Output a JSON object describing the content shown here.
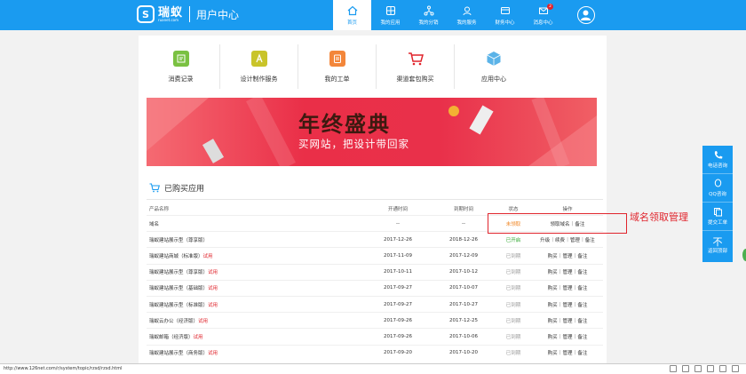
{
  "header": {
    "logo_mark": "S",
    "logo_name": "瑞蚁",
    "logo_url": "ruanet.com",
    "page_title": "用户中心",
    "nav": [
      {
        "label": "首页",
        "icon": "home-icon",
        "active": true
      },
      {
        "label": "我的应用",
        "icon": "grid-icon"
      },
      {
        "label": "我的分销",
        "icon": "share-icon"
      },
      {
        "label": "我的服务",
        "icon": "service-icon"
      },
      {
        "label": "财务中心",
        "icon": "wallet-icon"
      },
      {
        "label": "消息中心",
        "icon": "mail-icon",
        "badge": "2"
      }
    ]
  },
  "quick_links": [
    {
      "label": "消费记录",
      "icon": "bill-icon",
      "color": "#7ac142"
    },
    {
      "label": "设计制作服务",
      "icon": "design-icon",
      "color": "#c9c42a"
    },
    {
      "label": "我的工单",
      "icon": "clipboard-icon",
      "color": "#f3863a"
    },
    {
      "label": "渠道套包购买",
      "icon": "cart-icon",
      "color": "#e0242c"
    },
    {
      "label": "应用中心",
      "icon": "cube-icon",
      "color": "#45a8e0"
    }
  ],
  "banner": {
    "title": "年终盛典",
    "subtitle": "买网站，把设计带回家"
  },
  "section": {
    "title": "已购买应用"
  },
  "table": {
    "headers": [
      "产品名称",
      "开通时间",
      "到期时间",
      "状态",
      "操作"
    ],
    "rows": [
      {
        "name": "域名",
        "trial": "",
        "open": "--",
        "expire": "--",
        "status": "未领取",
        "status_kind": "orange",
        "ops": [
          "领取域名",
          "备注"
        ]
      },
      {
        "name": "瑞蚁建站展示型（尊享版）",
        "trial": "",
        "open": "2017-12-26",
        "expire": "2018-12-26",
        "status": "已开启",
        "status_kind": "green",
        "ops": [
          "升级",
          "续费",
          "管理",
          "备注"
        ]
      },
      {
        "name": "瑞蚁建站商城（标准版）",
        "trial": "试用",
        "open": "2017-11-09",
        "expire": "2017-12-09",
        "status": "已到期",
        "status_kind": "gray",
        "ops": [
          "购买",
          "管理",
          "备注"
        ]
      },
      {
        "name": "瑞蚁建站展示型（尊享版）",
        "trial": "试用",
        "open": "2017-10-11",
        "expire": "2017-10-12",
        "status": "已到期",
        "status_kind": "gray",
        "ops": [
          "购买",
          "管理",
          "备注"
        ]
      },
      {
        "name": "瑞蚁建站展示型（基础版）",
        "trial": "试用",
        "open": "2017-09-27",
        "expire": "2017-10-07",
        "status": "已到期",
        "status_kind": "gray",
        "ops": [
          "购买",
          "管理",
          "备注"
        ]
      },
      {
        "name": "瑞蚁建站展示型（标准版）",
        "trial": "试用",
        "open": "2017-09-27",
        "expire": "2017-10-27",
        "status": "已到期",
        "status_kind": "gray",
        "ops": [
          "购买",
          "管理",
          "备注"
        ]
      },
      {
        "name": "瑞蚁云办公（经济版）",
        "trial": "试用",
        "open": "2017-09-26",
        "expire": "2017-12-25",
        "status": "已到期",
        "status_kind": "gray",
        "ops": [
          "购买",
          "管理",
          "备注"
        ]
      },
      {
        "name": "瑞蚁邮箱（经济版）",
        "trial": "试用",
        "open": "2017-09-26",
        "expire": "2017-10-06",
        "status": "已到期",
        "status_kind": "gray",
        "ops": [
          "购买",
          "管理",
          "备注"
        ]
      },
      {
        "name": "瑞蚁建站展示型（商务版）",
        "trial": "试用",
        "open": "2017-09-20",
        "expire": "2017-10-20",
        "status": "已到期",
        "status_kind": "gray",
        "ops": [
          "购买",
          "管理",
          "备注"
        ]
      }
    ]
  },
  "annotation": {
    "text": "域名领取管理",
    "color": "#e0242c"
  },
  "side_tools": [
    {
      "label": "电话咨询",
      "icon": "phone-icon"
    },
    {
      "label": "QQ咨询",
      "icon": "qq-icon"
    },
    {
      "label": "提交工单",
      "icon": "ticket-icon"
    },
    {
      "label": "返回顶部",
      "icon": "arrow-up-icon"
    }
  ],
  "side_tools_top_glyph": "不",
  "status_bar": {
    "url": "http://www.126net.com/r/system/topic/rzsd/rzsd.html"
  },
  "colors": {
    "brand": "#1a9bf0",
    "danger": "#e0242c",
    "success": "#29a629",
    "warning": "#f0831e"
  }
}
